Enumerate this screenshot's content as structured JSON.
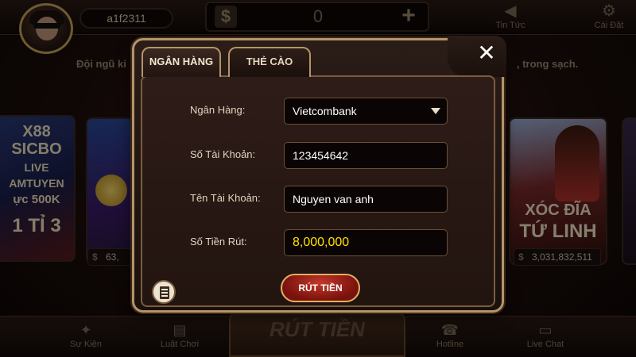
{
  "topbar": {
    "username": "a1f2311",
    "balance": "0",
    "balance_currency_icon": "dollar-icon",
    "add_icon": "plus-icon",
    "news_label": "Tin Tức",
    "settings_label": "Cài Đặt"
  },
  "news_ticker": {
    "left_text": "Đội ngũ ki",
    "right_text": ", trong sạch."
  },
  "games": [
    {
      "title_lines": [
        "X88",
        "SICBO",
        "LIVE",
        "AMTUYEN",
        "ực 500K",
        "1 TỈ 3"
      ],
      "jackpot": "63,"
    },
    {
      "title_lines": [
        "XÓC ĐĨA",
        "TỨ LINH"
      ],
      "jackpot": "3,031,832,511"
    }
  ],
  "bottombar": {
    "event_label": "Sự Kiện",
    "rules_label": "Luật Chơi",
    "center_label": "RÚT TIỀN",
    "hotline_label": "Hotline",
    "livechat_label": "Live Chat"
  },
  "dialog": {
    "tabs": [
      {
        "label": "NGÂN HÀNG",
        "active": true
      },
      {
        "label": "THẺ CÀO",
        "active": false
      }
    ],
    "close_glyph": "✕",
    "form": {
      "bank_label": "Ngân Hàng:",
      "bank_value": "Vietcombank",
      "account_number_label": "Số Tài Khoản:",
      "account_number_value": "123454642",
      "account_name_label": "Tên Tài Khoản:",
      "account_name_value": "Nguyen van anh",
      "amount_label": "Số Tiền Rút:",
      "amount_value": "8,000,000"
    },
    "withdraw_button": "RÚT TIỀN"
  },
  "colors": {
    "accent_gold": "#b4946a",
    "amount_yellow": "#ffe100",
    "button_red": "#7a120c"
  }
}
